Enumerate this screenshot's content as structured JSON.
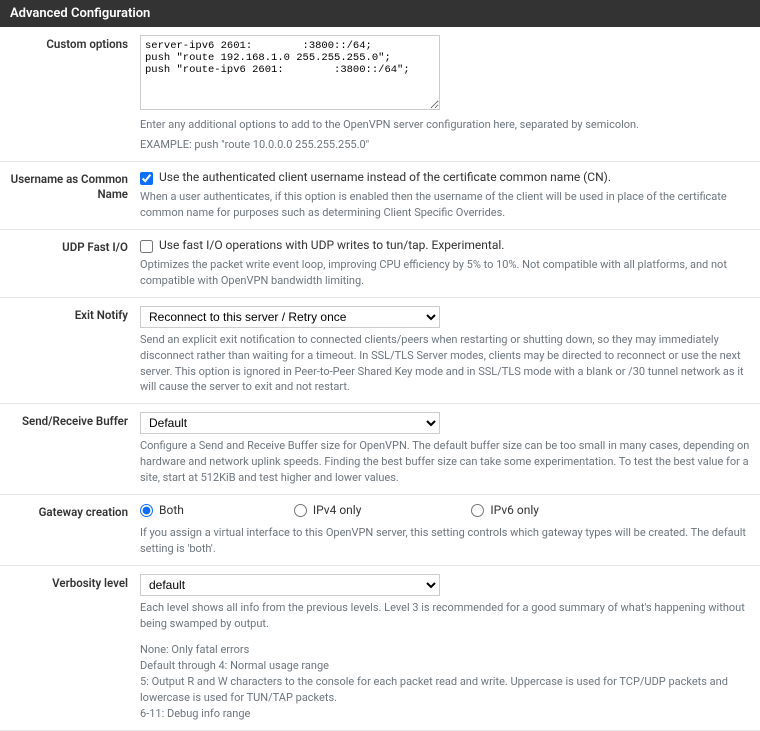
{
  "section_title": "Advanced Configuration",
  "custom_options": {
    "label": "Custom options",
    "value": "server-ipv6 2601:        :3800::/64;\npush \"route 192.168.1.0 255.255.255.0\";\npush \"route-ipv6 2601:        :3800::/64\";",
    "help1": "Enter any additional options to add to the OpenVPN server configuration here, separated by semicolon.",
    "help2": "EXAMPLE: push \"route 10.0.0.0 255.255.255.0\""
  },
  "username_cn": {
    "label": "Username as Common Name",
    "checked": true,
    "checkbox_label": "Use the authenticated client username instead of the certificate common name (CN).",
    "help": "When a user authenticates, if this option is enabled then the username of the client will be used in place of the certificate common name for purposes such as determining Client Specific Overrides."
  },
  "udp_fast_io": {
    "label": "UDP Fast I/O",
    "checked": false,
    "checkbox_label": "Use fast I/O operations with UDP writes to tun/tap. Experimental.",
    "help": "Optimizes the packet write event loop, improving CPU efficiency by 5% to 10%. Not compatible with all platforms, and not compatible with OpenVPN bandwidth limiting."
  },
  "exit_notify": {
    "label": "Exit Notify",
    "selected": "Reconnect to this server / Retry once",
    "help": "Send an explicit exit notification to connected clients/peers when restarting or shutting down, so they may immediately disconnect rather than waiting for a timeout. In SSL/TLS Server modes, clients may be directed to reconnect or use the next server. This option is ignored in Peer-to-Peer Shared Key mode and in SSL/TLS mode with a blank or /30 tunnel network as it will cause the server to exit and not restart."
  },
  "send_recv_buffer": {
    "label": "Send/Receive Buffer",
    "selected": "Default",
    "help": "Configure a Send and Receive Buffer size for OpenVPN. The default buffer size can be too small in many cases, depending on hardware and network uplink speeds. Finding the best buffer size can take some experimentation. To test the best value for a site, start at 512KiB and test higher and lower values."
  },
  "gateway_creation": {
    "label": "Gateway creation",
    "options": {
      "both": "Both",
      "ipv4": "IPv4 only",
      "ipv6": "IPv6 only"
    },
    "selected": "both",
    "help": "If you assign a virtual interface to this OpenVPN server, this setting controls which gateway types will be created. The default setting is 'both'."
  },
  "verbosity": {
    "label": "Verbosity level",
    "selected": "default",
    "help1": "Each level shows all info from the previous levels. Level 3 is recommended for a good summary of what's happening without being swamped by output.",
    "help2": "None: Only fatal errors",
    "help3": "Default through 4: Normal usage range",
    "help4": "5: Output R and W characters to the console for each packet read and write. Uppercase is used for TCP/UDP packets and lowercase is used for TUN/TAP packets.",
    "help5": "6-11: Debug info range"
  }
}
